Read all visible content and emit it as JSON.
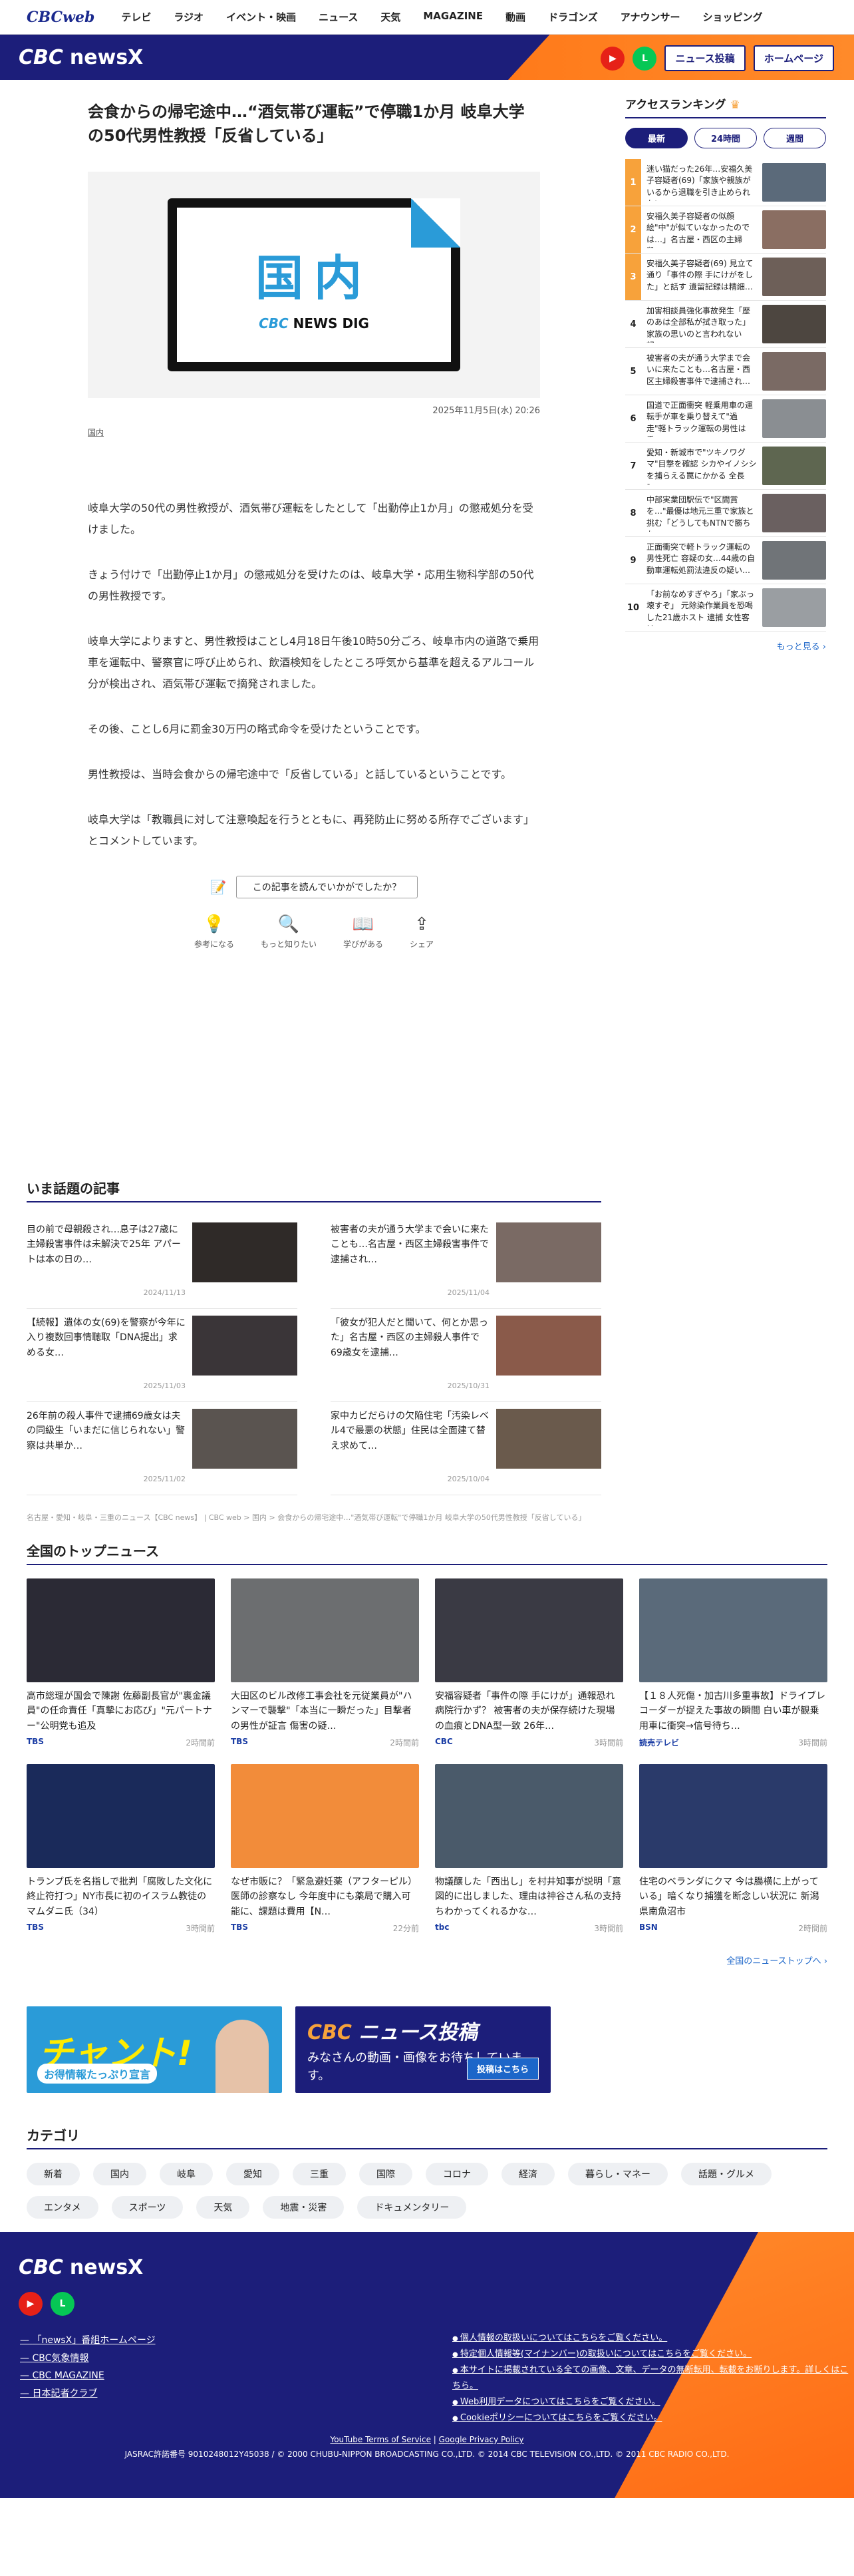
{
  "topnav": {
    "logo": "CBCweb",
    "items": [
      "テレビ",
      "ラジオ",
      "イベント・映画",
      "ニュース",
      "天気",
      "MAGAZINE",
      "動画",
      "ドラゴンズ",
      "アナウンサー",
      "ショッピング"
    ]
  },
  "header": {
    "brand_prefix": "CBC",
    "brand": "newsX",
    "post_button": "ニュース投稿",
    "home_button": "ホームページ"
  },
  "article": {
    "title": "会食からの帰宅途中…“酒気帯び運転”で停職1か月 岐阜大学の50代男性教授「反省している」",
    "hero_word": "国内",
    "hero_brand_prefix": "CBC",
    "hero_brand": "NEWS DIG",
    "date": "2025年11月5日(水) 20:26",
    "category": "国内",
    "paragraphs": [
      "岐阜大学の50代の男性教授が、酒気帯び運転をしたとして「出勤停止1か月」の懲戒処分を受けました。",
      "きょう付けで「出勤停止1か月」の懲戒処分を受けたのは、岐阜大学・応用生物科学部の50代の男性教授です。",
      "岐阜大学によりますと、男性教授はことし4月18日午後10時50分ごろ、岐阜市内の道路で乗用車を運転中、警察官に呼び止められ、飲酒検知をしたところ呼気から基準を超えるアルコール分が検出され、酒気帯び運転で摘発されました。",
      "その後、ことし6月に罰金30万円の略式命令を受けたということです。",
      "男性教授は、当時会食からの帰宅途中で「反省している」と話しているということです。",
      "岐阜大学は「教職員に対して注意喚起を行うとともに、再発防止に努める所存でございます」とコメントしています。"
    ],
    "feedback_question": "この記事を読んでいかがでしたか？",
    "feedback": [
      {
        "icon": "💡",
        "label": "参考になる"
      },
      {
        "icon": "🔍",
        "label": "もっと知りたい"
      },
      {
        "icon": "📖",
        "label": "学びがある"
      },
      {
        "icon": "⇪",
        "label": "シェア"
      }
    ]
  },
  "sidebar": {
    "title": "アクセスランキング",
    "tabs": [
      "最新",
      "24時間",
      "週間"
    ],
    "ranks": [
      {
        "num": "1",
        "text": "迷い猫だった26年…安福久美子容疑者(69)「家族や親族がいるから退職を引き止められない…",
        "color": "#5b6a7a"
      },
      {
        "num": "2",
        "text": "安福久美子容疑者の似顔絵\"中\"が似ていなかったのでは…」名古屋・西区の主婦殺…",
        "color": "#8a6e62"
      },
      {
        "num": "3",
        "text": "安福久美子容疑者(69) 見立て通り「事件の際 手にけがをした」と話す 遺留記録は精細…",
        "color": "#6d5f58"
      },
      {
        "num": "4",
        "text": "加害相談員強化事故発生「歴のあは全部私が拭き取った」家族の思いのと言われない記…",
        "color": "#4d4640"
      },
      {
        "num": "5",
        "text": "被害者の夫が通う大学まで会いに来たことも…名古屋・西区主婦殺害事件で逮捕され…",
        "color": "#7a6a64"
      },
      {
        "num": "6",
        "text": "国道で正面衝突 軽乗用車の運転手が車を乗り替えて\"過走\"軽トラック運転の男性は重…",
        "color": "#8a8e92"
      },
      {
        "num": "7",
        "text": "愛知・新城市で\"ツキノワグマ\"目撃を確認 シカやイノシシを捕らえる罠にかかる 全長1…",
        "color": "#5e6650"
      },
      {
        "num": "8",
        "text": "中部実業団駅伝で\"区間賞を…\"最優は地元三重で家族と挑む「どうしてもNTNで勝ちた…",
        "color": "#6a6060"
      },
      {
        "num": "9",
        "text": "正面衝突で軽トラック運転の男性死亡 容疑の女…44歳の自動車運転処罰法違反の疑い…",
        "color": "#707478"
      },
      {
        "num": "10",
        "text": "「お前なめすぎやろ」「家ぶっ壊すぞ」 元除染作業員を恐喝した21歳ホスト 逮捕 女性客は…",
        "color": "#9a9ea2"
      }
    ],
    "more": "もっと見る"
  },
  "trending": {
    "title": "いま話題の記事",
    "items": [
      {
        "title": "目の前で母親殺され…息子は27歳に 主婦殺害事件は未解決で25年 アパートは本の日の…",
        "date": "2024/11/13",
        "color": "#2f2a28"
      },
      {
        "title": "被害者の夫が通う大学まで会いに来たことも…名古屋・西区主婦殺害事件で逮捕され…",
        "date": "2025/11/04",
        "color": "#7a6a64"
      },
      {
        "title": "【続報】遺体の女(69)を警察が今年に入り複数回事情聴取「DNA提出」求める女…",
        "date": "2025/11/03",
        "color": "#3a3538"
      },
      {
        "title": "「彼女が犯人だと聞いて、何とか思った」名古屋・西区の主婦殺人事件で69歳女を逮捕…",
        "date": "2025/10/31",
        "color": "#8a5a4a"
      },
      {
        "title": "26年前の殺人事件で逮捕69歳女は夫の同級生「いまだに信じられない」警察は共単か…",
        "date": "2025/11/02",
        "color": "#5a5450"
      },
      {
        "title": "家中カビだらけの欠陥住宅「汚染レベル4で最悪の状態」住民は全面建て替え求めて…",
        "date": "2025/10/04",
        "color": "#6a5a4c"
      }
    ]
  },
  "breadcrumb": "名古屋・愛知・岐阜・三重のニュース【CBC news】 | CBC web > 国内 > 会食からの帰宅途中…\"酒気帯び運転\"で停職1か月 岐阜大学の50代男性教授「反省している」",
  "national": {
    "title": "全国のトップニュース",
    "items": [
      {
        "title": "高市総理が国会で陳謝 佐藤副長官が\"裏金議員\"の任命責任「真摯にお応び」\"元パートナー\"公明党も追及",
        "src": "TBS",
        "time": "2時間前",
        "color": "#2b2a35"
      },
      {
        "title": "大田区のビル改修工事会社を元従業員が\"ハンマーで襲撃\"「本当に一瞬だった」目撃者の男性が証言 傷害の疑…",
        "src": "TBS",
        "time": "2時間前",
        "color": "#6c6e70"
      },
      {
        "title": "安福容疑者「事件の際 手にけが」通報恐れ病院行かず？ 被害者の夫が保存続けた現場の血痕とDNA型一致 26年…",
        "src": "CBC",
        "time": "3時間前",
        "color": "#3a3a44"
      },
      {
        "title": "【１８人死傷・加古川多重事故】ドライブレコーダーが捉えた事故の瞬間 白い車が観乗用車に衝突→信号待ち…",
        "src": "読売テレビ",
        "time": "3時間前",
        "color": "#5a6a7a"
      },
      {
        "title": "トランプ氏を名指しで批判「腐敗した文化に終止符打つ」NY市長に初のイスラム教徒のマムダニ氏（34）",
        "src": "TBS",
        "time": "3時間前",
        "color": "#1a2a5a"
      },
      {
        "title": "なぜ市販に？「緊急避妊薬（アフターピル）医師の診察なし 今年度中にも薬局で購入可能に、課題は費用【N…",
        "src": "TBS",
        "time": "22分前",
        "color": "#f28c3a"
      },
      {
        "title": "物議醸した「西出し」を村井知事が説明「意図的に出しました、理由は神谷さん私の支持ちわかってくれるかな…",
        "src": "tbc",
        "time": "3時間前",
        "color": "#4a5a6a"
      },
      {
        "title": "住宅のベランダにクマ 今は腸横に上がっている」暗くなり捕獲を断念しい状況に 新潟県南魚沼市",
        "src": "BSN",
        "time": "2時間前",
        "color": "#2a3a6a"
      }
    ],
    "more": "全国のニューストップへ"
  },
  "banners": {
    "b1_big": "チャント!",
    "b1_small": "お得情報たっぷり宣言",
    "b2_head_prefix": "CBC",
    "b2_head": "ニュース投稿",
    "b2_text": "みなさんの動画・画像をお待ちしています。",
    "b2_btn": "投稿はこちら"
  },
  "category": {
    "title": "カテゴリ",
    "chips": [
      "新着",
      "国内",
      "岐阜",
      "愛知",
      "三重",
      "国際",
      "コロナ",
      "経済",
      "暮らし・マネー",
      "話題・グルメ",
      "エンタメ",
      "スポーツ",
      "天気",
      "地震・災害",
      "ドキュメンタリー"
    ]
  },
  "footer": {
    "brand_prefix": "CBC",
    "brand": "newsX",
    "links": [
      "「newsX」番組ホームページ",
      "CBC気象情報",
      "CBC MAGAZINE",
      "日本記者クラブ"
    ],
    "policies": [
      "個人情報の取扱いについてはこちらをご覧ください。",
      "特定個人情報等(マイナンバー)の取扱いについてはこちらをご覧ください。",
      "本サイトに掲載されている全ての画像、文章、データの無断転用、転載をお断りします。詳しくはこちら。",
      "Web利用データについてはこちらをご覧ください。",
      "Cookieポリシーについてはこちらをご覧ください。"
    ],
    "yt_terms": "YouTube Terms of Service",
    "privacy": "Google Privacy Policy",
    "copyright": "JASRAC許諾番号 9010248012Y45038 / © 2000 CHUBU-NIPPON BROADCASTING CO.,LTD. © 2014 CBC TELEVISION CO.,LTD. © 2011 CBC RADIO CO.,LTD."
  }
}
